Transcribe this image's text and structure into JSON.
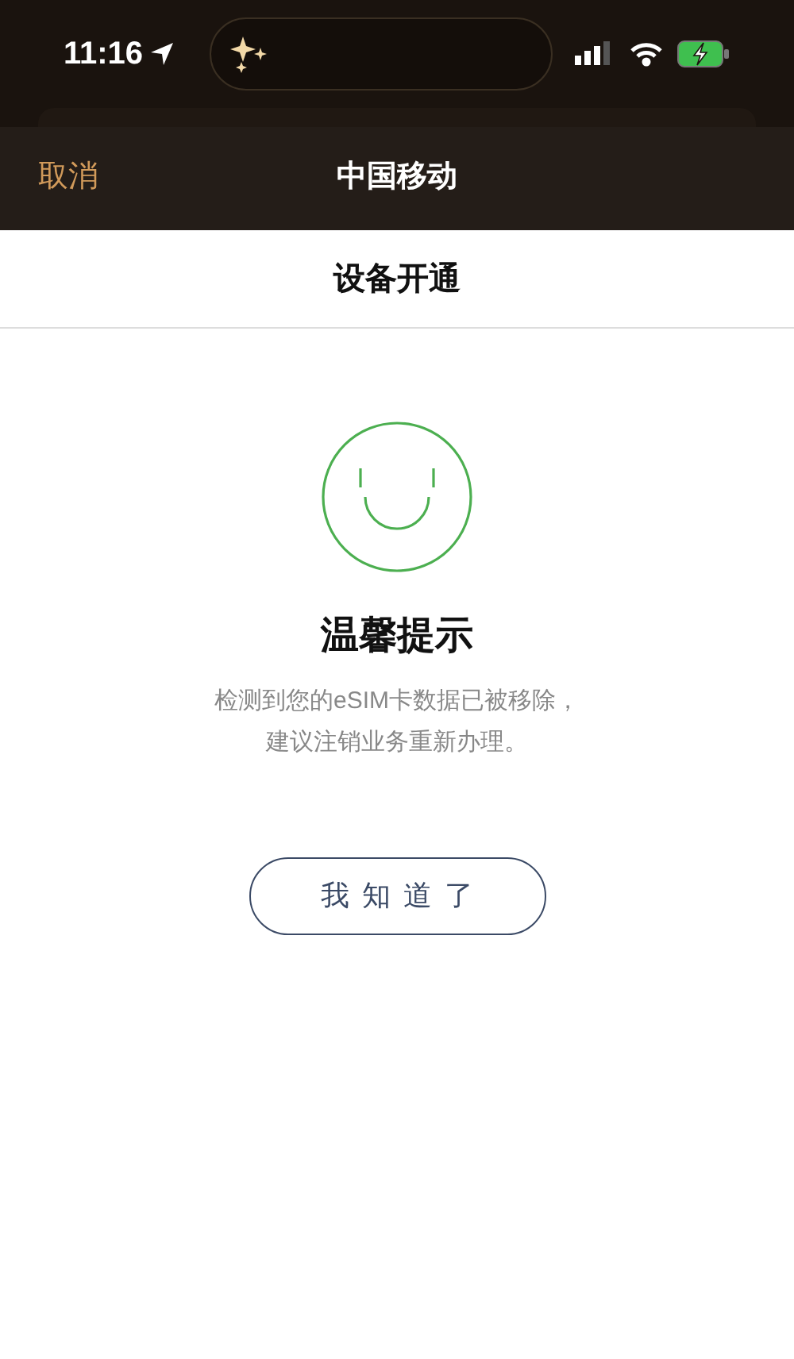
{
  "status_bar": {
    "time": "11:16"
  },
  "nav": {
    "cancel": "取消",
    "title": "中国移动"
  },
  "page_title": "设备开通",
  "notice": {
    "title": "温馨提示",
    "lines": [
      "检测到您的eSIM卡数据已被移除，",
      "建议注销业务重新办理。"
    ]
  },
  "button": "我知道了"
}
